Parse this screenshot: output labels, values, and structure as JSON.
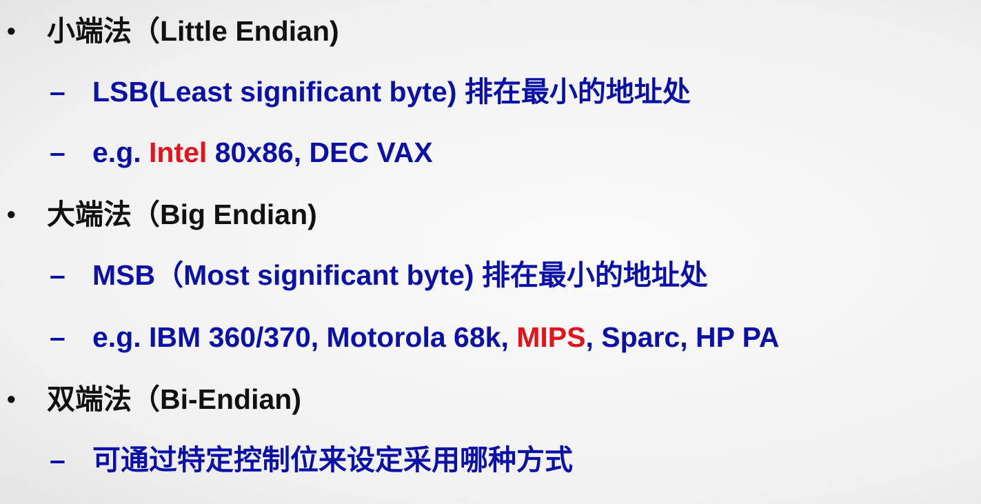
{
  "colors": {
    "heading": "#111111",
    "body": "#0b11a6",
    "highlight": "#e0141a"
  },
  "lines": [
    {
      "level": 1,
      "marker": "•",
      "segments": [
        {
          "text": "小端法（Little Endian)"
        }
      ]
    },
    {
      "level": 2,
      "marker": "–",
      "segments": [
        {
          "text": "LSB(Least significant byte) 排在最小的地址处"
        }
      ]
    },
    {
      "level": 2,
      "marker": "–",
      "segments": [
        {
          "text": "e.g. "
        },
        {
          "text": "Intel",
          "highlight": true
        },
        {
          "text": " 80x86, DEC VAX"
        }
      ]
    },
    {
      "level": 1,
      "marker": "•",
      "segments": [
        {
          "text": "大端法（Big Endian)"
        }
      ]
    },
    {
      "level": 2,
      "marker": "–",
      "segments": [
        {
          "text": "MSB（Most significant byte) 排在最小的地址处"
        }
      ]
    },
    {
      "level": 2,
      "marker": "–",
      "segments": [
        {
          "text": "e.g. IBM 360/370, Motorola 68k, "
        },
        {
          "text": "MIPS",
          "highlight": true
        },
        {
          "text": ", Sparc, HP PA"
        }
      ]
    },
    {
      "level": 1,
      "marker": "•",
      "segments": [
        {
          "text": "双端法（Bi-Endian)"
        }
      ]
    },
    {
      "level": 2,
      "marker": "–",
      "segments": [
        {
          "text": "可通过特定控制位来设定采用哪种方式"
        }
      ]
    }
  ]
}
